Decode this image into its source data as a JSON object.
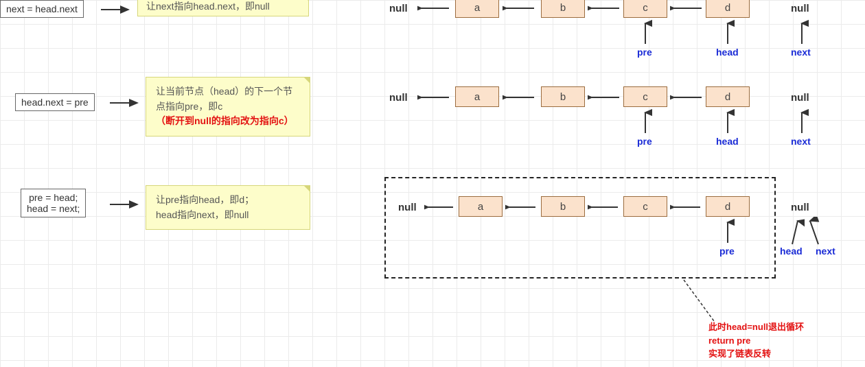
{
  "steps": {
    "s1": {
      "code": "next = head.next",
      "note": "让next指向head.next，即null"
    },
    "s2": {
      "code": "head.next = pre",
      "note_l1": "让当前节点（head）的下一个节点指向pre，即c",
      "note_l2": "（断开到null的指向改为指向c）"
    },
    "s3": {
      "code": "pre = head;\nhead = next;",
      "note": "让pre指向head，即d；\nhead指向next，即null"
    }
  },
  "nodes": {
    "a": "a",
    "b": "b",
    "c": "c",
    "d": "d"
  },
  "labels": {
    "null": "null",
    "pre": "pre",
    "head": "head",
    "next": "next"
  },
  "conclusion": {
    "l1": "此时head=null退出循环",
    "l2": "return pre",
    "l3": "实现了链表反转"
  }
}
